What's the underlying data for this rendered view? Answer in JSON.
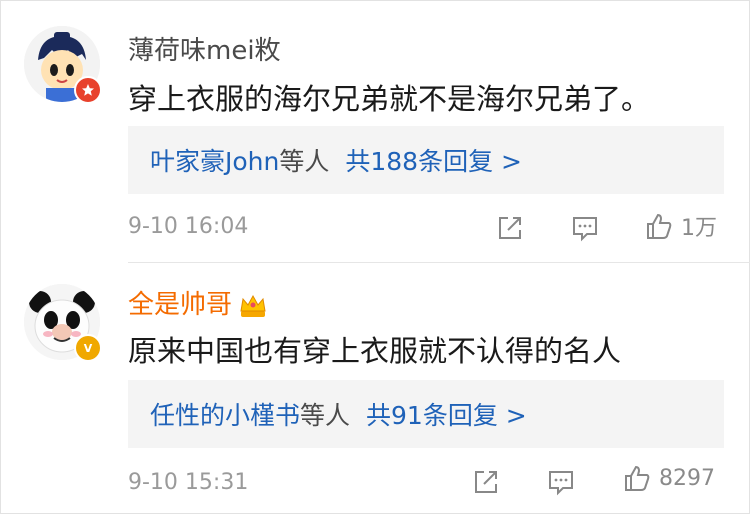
{
  "comments": [
    {
      "username": "薄荷味mei敉",
      "content": "穿上衣服的海尔兄弟就不是海尔兄弟了。",
      "reply_preview": {
        "names": "叶家豪John",
        "suffix": "等人",
        "count": "共188条回复 >"
      },
      "timestamp": "9-10 16:04",
      "likes": "1万",
      "avatar": "cartoon-boy-avatar",
      "badge": "red-star-badge"
    },
    {
      "username": "全是帅哥",
      "content": "原来中国也有穿上衣服就不认得的名人",
      "reply_preview": {
        "names": "任性的小槿书",
        "suffix": "等人",
        "count": "共91条回复 >"
      },
      "timestamp": "9-10 15:31",
      "likes": "8297",
      "avatar": "panda-meme-avatar",
      "badge": "gold-verified-badge"
    }
  ],
  "colors": {
    "link": "#1f62b8",
    "vip_name": "#f46b00",
    "meta": "#9a9a9a",
    "reply_bg": "#f4f4f4"
  }
}
